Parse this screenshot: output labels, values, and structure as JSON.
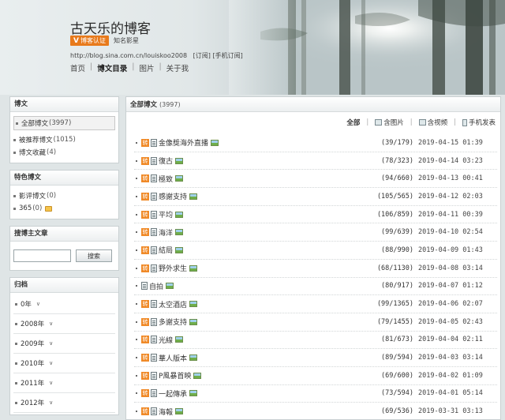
{
  "header": {
    "blog_title": "古天乐的博客",
    "verified_label": "博客认证",
    "verified_v": "V",
    "verified_desc": "知名影星",
    "url": "http://blog.sina.com.cn/louiskoo2008",
    "subscribe": "[订阅]",
    "mobile_subscribe": "[手机订阅]",
    "nav": [
      "首页",
      "博文目录",
      "图片",
      "关于我"
    ],
    "nav_active": "博文目录"
  },
  "sidebar": {
    "posts_box": {
      "title": "博文",
      "items": [
        {
          "label": "全部博文",
          "count": "(3997)"
        },
        {
          "label": "被推荐博文",
          "count": "(1015)"
        },
        {
          "label": "博文收藏",
          "count": "(4)"
        }
      ]
    },
    "special_box": {
      "title": "特色博文",
      "items": [
        {
          "label": "影评博文",
          "count": "(0)"
        },
        {
          "label": "365",
          "count": "(0)"
        }
      ]
    },
    "search_box": {
      "title": "搜博主文章",
      "input_value": "",
      "button_label": "搜索"
    },
    "archive_box": {
      "title": "归档",
      "items": [
        "0年",
        "2008年",
        "2009年",
        "2010年",
        "2011年",
        "2012年"
      ]
    }
  },
  "main": {
    "title": "全部博文",
    "count": "(3997)",
    "filters": {
      "all": "全部",
      "with_images": "含图片",
      "with_video": "含视频",
      "mobile_post": "手机发表"
    },
    "posts": [
      {
        "title": "金像獎海外直播",
        "stat": "(39/179)",
        "date": "2019-04-15 01:39",
        "zhuan": true,
        "img": true
      },
      {
        "title": "復古",
        "stat": "(78/323)",
        "date": "2019-04-14 03:23",
        "zhuan": true,
        "img": true
      },
      {
        "title": "極致",
        "stat": "(94/660)",
        "date": "2019-04-13 00:41",
        "zhuan": true,
        "img": true
      },
      {
        "title": "感謝支持",
        "stat": "(105/565)",
        "date": "2019-04-12 02:03",
        "zhuan": true,
        "img": true
      },
      {
        "title": "平均",
        "stat": "(106/859)",
        "date": "2019-04-11 00:39",
        "zhuan": true,
        "img": true
      },
      {
        "title": "海洋",
        "stat": "(99/639)",
        "date": "2019-04-10 02:54",
        "zhuan": true,
        "img": true
      },
      {
        "title": "結局",
        "stat": "(88/990)",
        "date": "2019-04-09 01:43",
        "zhuan": true,
        "img": true
      },
      {
        "title": "野外求生",
        "stat": "(68/1130)",
        "date": "2019-04-08 03:14",
        "zhuan": true,
        "img": true
      },
      {
        "title": "自拍",
        "stat": "(80/917)",
        "date": "2019-04-07 01:12",
        "zhuan": false,
        "img": true
      },
      {
        "title": "太空酒店",
        "stat": "(99/1365)",
        "date": "2019-04-06 02:07",
        "zhuan": true,
        "img": true
      },
      {
        "title": "多謝支持",
        "stat": "(79/1455)",
        "date": "2019-04-05 02:43",
        "zhuan": true,
        "img": true
      },
      {
        "title": "光線",
        "stat": "(81/673)",
        "date": "2019-04-04 02:11",
        "zhuan": true,
        "img": true
      },
      {
        "title": "華人版本",
        "stat": "(89/594)",
        "date": "2019-04-03 03:14",
        "zhuan": true,
        "img": true
      },
      {
        "title": "P風暴首映",
        "stat": "(69/600)",
        "date": "2019-04-02 01:09",
        "zhuan": true,
        "img": true
      },
      {
        "title": "一起傳承",
        "stat": "(73/594)",
        "date": "2019-04-01 05:14",
        "zhuan": true,
        "img": true
      },
      {
        "title": "海報",
        "stat": "(69/536)",
        "date": "2019-03-31 03:13",
        "zhuan": true,
        "img": true
      }
    ],
    "zhuan_label": "转"
  }
}
